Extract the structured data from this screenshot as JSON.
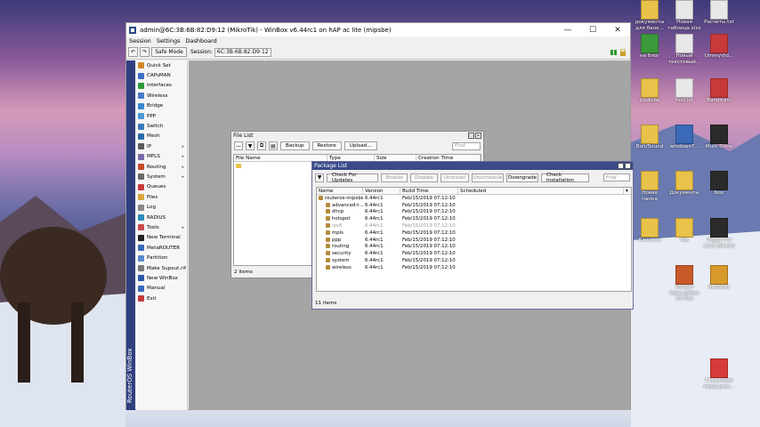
{
  "window": {
    "title": "admin@6C:3B:6B:82:D9:12 (MikroTik) - WinBox v6.44rc1 on hAP ac lite (mipsbe)",
    "controls": {
      "minimize": "—",
      "maximize": "☐",
      "close": "✕"
    }
  },
  "menu": {
    "session": "Session",
    "settings": "Settings",
    "dashboard": "Dashboard"
  },
  "toolbar": {
    "undo": "↶",
    "redo": "↷",
    "safe_mode": "Safe Mode",
    "session_label": "Session:",
    "session_value": "6C:3B:6B:82:D9:12"
  },
  "brand": "RouterOS WinBox",
  "sidebar": [
    {
      "label": "Quick Set",
      "color": "#d08a2a",
      "submenu": false
    },
    {
      "label": "CAPsMAN",
      "color": "#3c6fc8",
      "submenu": false
    },
    {
      "label": "Interfaces",
      "color": "#2f9a3a",
      "submenu": false
    },
    {
      "label": "Wireless",
      "color": "#4a7ac8",
      "submenu": false
    },
    {
      "label": "Bridge",
      "color": "#3a8ad0",
      "submenu": false
    },
    {
      "label": "PPP",
      "color": "#4a9ad8",
      "submenu": false
    },
    {
      "label": "Switch",
      "color": "#3a7ab8",
      "submenu": false
    },
    {
      "label": "Mesh",
      "color": "#2a6aa8",
      "submenu": false
    },
    {
      "label": "IP",
      "color": "#5a5a5a",
      "submenu": true
    },
    {
      "label": "MPLS",
      "color": "#7a6aa8",
      "submenu": true
    },
    {
      "label": "Routing",
      "color": "#c84a2a",
      "submenu": true
    },
    {
      "label": "System",
      "color": "#6a6a6a",
      "submenu": true
    },
    {
      "label": "Queues",
      "color": "#c83a3a",
      "submenu": false
    },
    {
      "label": "Files",
      "color": "#d8a83a",
      "submenu": false
    },
    {
      "label": "Log",
      "color": "#8a8a8a",
      "submenu": false
    },
    {
      "label": "RADIUS",
      "color": "#2a8ab8",
      "submenu": false
    },
    {
      "label": "Tools",
      "color": "#c84a4a",
      "submenu": true
    },
    {
      "label": "New Terminal",
      "color": "#222222",
      "submenu": false
    },
    {
      "label": "MetaROUTER",
      "color": "#3a6ab8",
      "submenu": false
    },
    {
      "label": "Partition",
      "color": "#5a8ac8",
      "submenu": false
    },
    {
      "label": "Make Supout.rif",
      "color": "#7a7a7a",
      "submenu": false
    },
    {
      "label": "New WinBox",
      "color": "#2a5aa8",
      "submenu": false
    },
    {
      "label": "Manual",
      "color": "#3a6ab8",
      "submenu": false
    },
    {
      "label": "Exit",
      "color": "#c83a3a",
      "submenu": false
    }
  ],
  "file_list": {
    "title": "File List",
    "buttons": {
      "backup": "Backup",
      "restore": "Restore",
      "upload": "Upload..."
    },
    "find": "Find",
    "columns": [
      "File Name",
      "Type",
      "Size",
      "Creation Time"
    ],
    "status": "2 items"
  },
  "package_list": {
    "title": "Package List",
    "buttons": {
      "check_updates": "Check For Updates",
      "enable": "Enable",
      "disable": "Disable",
      "uninstall": "Uninstall",
      "unschedule": "Unschedule",
      "downgrade": "Downgrade",
      "check_installation": "Check Installation"
    },
    "find": "Find",
    "columns": [
      "Name",
      "Version",
      "Build Time",
      "Scheduled"
    ],
    "rows": [
      {
        "name": "routeros-mipsbe",
        "version": "6.44rc1",
        "build": "Feb/15/2019 07:12:10",
        "scheduled": "",
        "dim": false
      },
      {
        "name": "advanced-t...",
        "version": "6.44rc1",
        "build": "Feb/15/2019 07:12:10",
        "scheduled": "",
        "dim": false
      },
      {
        "name": "dhcp",
        "version": "6.44rc1",
        "build": "Feb/15/2019 07:12:10",
        "scheduled": "",
        "dim": false
      },
      {
        "name": "hotspot",
        "version": "6.44rc1",
        "build": "Feb/15/2019 07:12:10",
        "scheduled": "",
        "dim": false
      },
      {
        "name": "ipv6",
        "version": "6.44rc1",
        "build": "Feb/15/2019 07:12:10",
        "scheduled": "",
        "dim": true
      },
      {
        "name": "mpls",
        "version": "6.44rc1",
        "build": "Feb/15/2019 07:12:10",
        "scheduled": "",
        "dim": false
      },
      {
        "name": "ppp",
        "version": "6.44rc1",
        "build": "Feb/15/2019 07:12:10",
        "scheduled": "",
        "dim": false
      },
      {
        "name": "routing",
        "version": "6.44rc1",
        "build": "Feb/15/2019 07:12:10",
        "scheduled": "",
        "dim": false
      },
      {
        "name": "security",
        "version": "6.44rc1",
        "build": "Feb/15/2019 07:12:10",
        "scheduled": "",
        "dim": false
      },
      {
        "name": "system",
        "version": "6.44rc1",
        "build": "Feb/15/2019 07:12:10",
        "scheduled": "",
        "dim": false
      },
      {
        "name": "wireless",
        "version": "6.44rc1",
        "build": "Feb/15/2019 07:12:10",
        "scheduled": "",
        "dim": false
      }
    ],
    "status": "11 items"
  },
  "desktop": [
    {
      "label": "документы для банк...",
      "color": "#e8c24a"
    },
    {
      "label": "Новая таблица.xlsx",
      "color": "#e8e8e8"
    },
    {
      "label": "Расчеты.txt",
      "color": "#e8e8e8"
    },
    {
      "label": "на блог",
      "color": "#3a9a3a"
    },
    {
      "label": "Новый текстовый...",
      "color": "#e8e8e8"
    },
    {
      "label": "UmmyVid...",
      "color": "#c83a3a"
    },
    {
      "label": "youtube",
      "color": "#e8c24a"
    },
    {
      "label": "test.txt",
      "color": "#e8e8e8"
    },
    {
      "label": "Bandicam",
      "color": "#c83a3a"
    },
    {
      "label": "Bolt/Sound",
      "color": "#e8c24a"
    },
    {
      "label": "windows7...",
      "color": "#3a6ab8"
    },
    {
      "label": "Multi Drive",
      "color": "#2a2a2a"
    },
    {
      "label": "Новая папка",
      "color": "#e8c24a"
    },
    {
      "label": "Документы",
      "color": "#e8c24a"
    },
    {
      "label": "Nox",
      "color": "#2a2a2a"
    },
    {
      "label": "Каннела",
      "color": "#e8c24a"
    },
    {
      "label": "Vas",
      "color": "#e8c24a"
    },
    {
      "label": "Vegas Pro 13.0 (64-bit)",
      "color": "#2a2a2a"
    },
    {
      "label": "Movavi Video Editor 14 Plus",
      "color": "#c85a2a"
    },
    {
      "label": "Audacity",
      "color": "#d89a2a"
    },
    {
      "label": "Страховая медицина...",
      "color": "#d83a3a"
    }
  ]
}
